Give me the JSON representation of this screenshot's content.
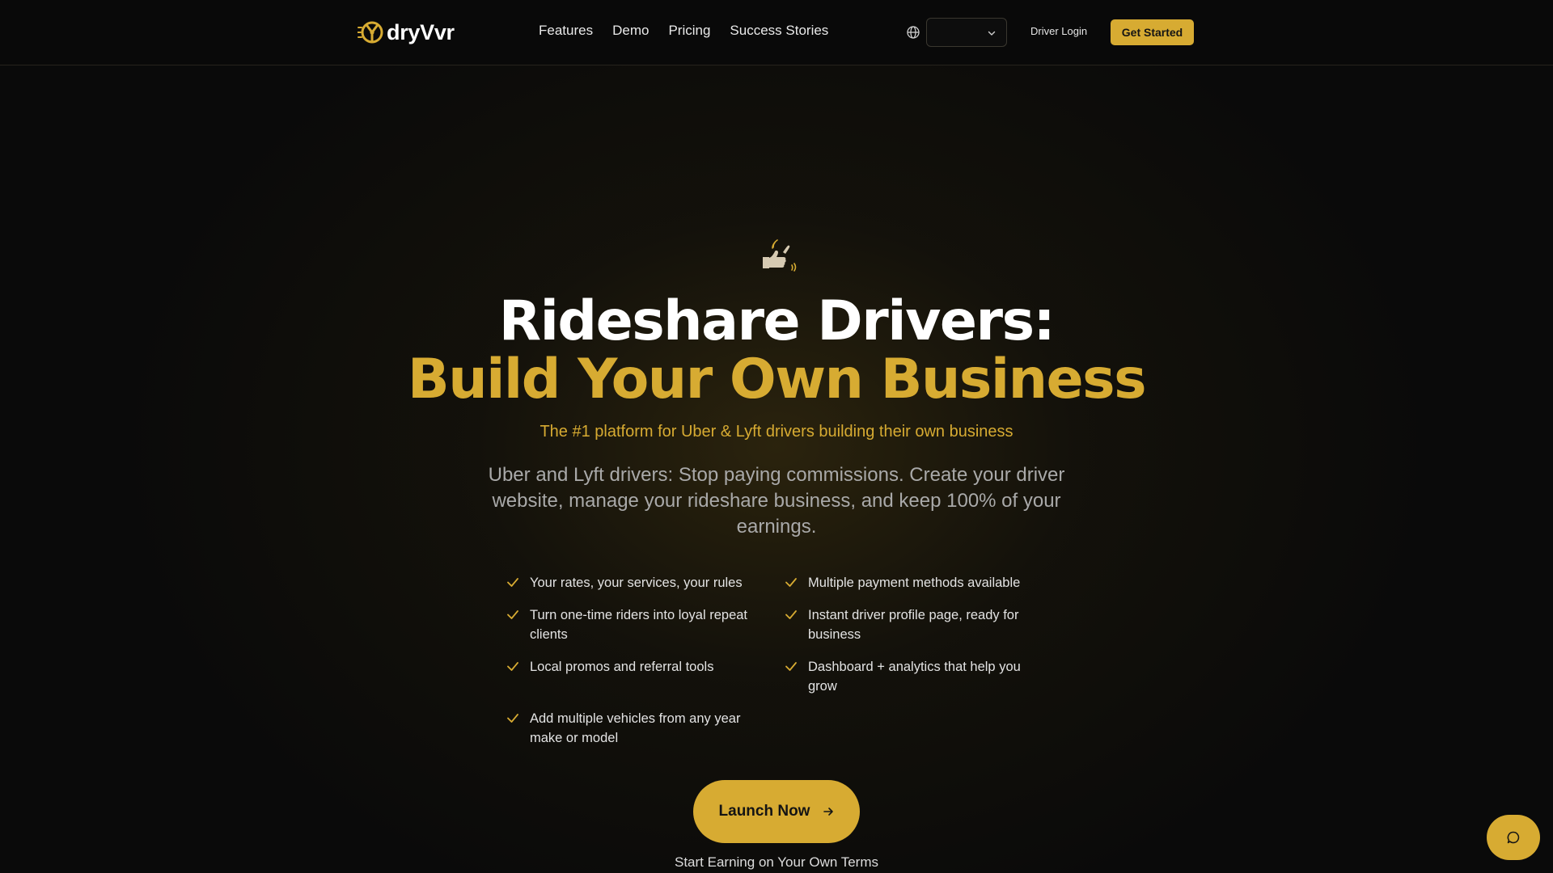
{
  "brand": {
    "name": "dryVvr"
  },
  "nav": {
    "items": [
      "Features",
      "Demo",
      "Pricing",
      "Success Stories"
    ]
  },
  "language_select": {
    "value": ""
  },
  "header_actions": {
    "login": "Driver Login",
    "cta": "Get Started"
  },
  "hero": {
    "emoji": "🤙",
    "title_line1": "Rideshare Drivers:",
    "title_line2": "Build Your Own Business",
    "tagline": "The #1 platform for Uber & Lyft drivers building their own business",
    "description": "Uber and Lyft drivers: Stop paying commissions. Create your driver website, manage your rideshare business, and keep 100% of your earnings.",
    "features": [
      "Your rates, your services, your rules",
      "Turn one-time riders into loyal repeat clients",
      "Local promos and referral tools",
      "Add multiple vehicles from any year make or model",
      "Multiple payment methods available",
      "Instant driver profile page, ready for business",
      "Dashboard + analytics that help you grow"
    ],
    "cta": "Launch Now",
    "subcta": "Start Earning on Your Own Terms"
  },
  "colors": {
    "accent": "#d7ab32",
    "background": "#0a0a0a",
    "text": "#ffffff",
    "muted": "#a9a9a9"
  },
  "icons": [
    "logo-icon",
    "globe-icon",
    "chevron-down-icon",
    "check-icon",
    "arrow-right-icon",
    "chat-icon"
  ]
}
